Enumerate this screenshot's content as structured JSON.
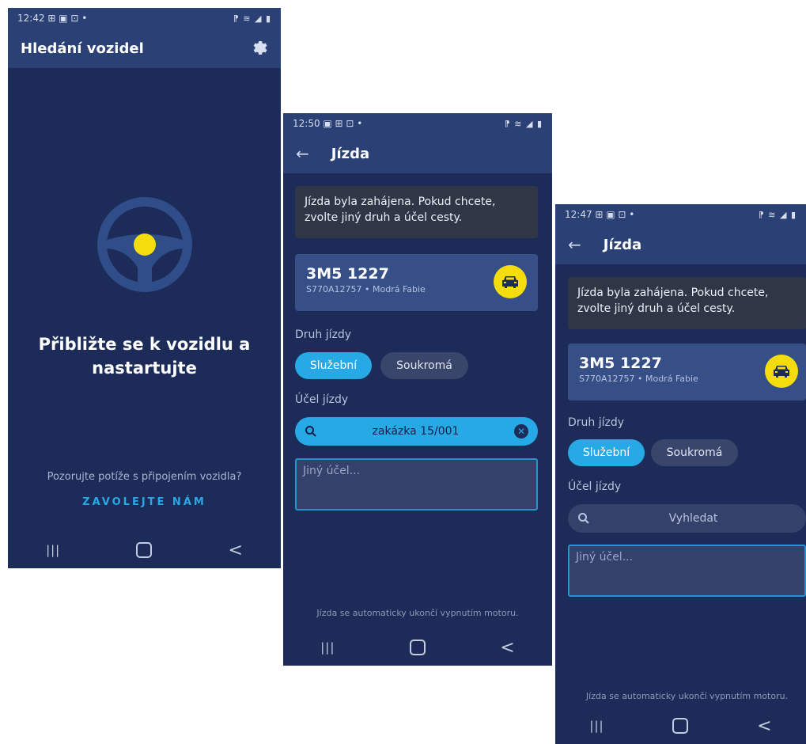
{
  "screen1": {
    "status": {
      "time": "12:42 ⊞ ▣ ⊡ •",
      "right": "⁋ ≋ ◢ ▮"
    },
    "title": "Hledání vozidel",
    "settings_icon": "gear-icon",
    "steering_icon": "steering-wheel-icon",
    "main_text": "Přibližte se k vozidlu a nastartujte",
    "trouble_text": "Pozorujte potíže s připojením vozidla?",
    "call_link": "ZAVOLEJTE NÁM",
    "nav": {
      "recent": "|||",
      "back": "<"
    }
  },
  "screen2": {
    "status": {
      "time": "12:50 ▣ ⊞ ⊡ •",
      "right": "⁋ ≋ ◢ ▮"
    },
    "back_icon": "←",
    "title": "Jízda",
    "info": "Jízda byla zahájena. Pokud chcete, zvolte jiný druh a účel cesty.",
    "vehicle": {
      "plate": "3M5 1227",
      "sub": "S770A12757 • Modrá Fabie",
      "icon": "car-icon"
    },
    "type_label": "Druh jízdy",
    "chips": [
      "Služební",
      "Soukromá"
    ],
    "purpose_label": "Účel jízdy",
    "search_value": "zakázka 15/001",
    "clear_glyph": "✕",
    "other_placeholder": "Jiný účel...",
    "footer": "Jízda se automaticky ukončí vypnutím motoru.",
    "nav": {
      "recent": "|||",
      "back": "<"
    }
  },
  "screen3": {
    "status": {
      "time": "12:47 ⊞ ▣ ⊡ •",
      "right": "⁋ ≋ ◢ ▮"
    },
    "back_icon": "←",
    "title": "Jízda",
    "info": "Jízda byla zahájena. Pokud chcete, zvolte jiný druh a účel cesty.",
    "vehicle": {
      "plate": "3M5 1227",
      "sub": "S770A12757 • Modrá Fabie",
      "icon": "car-icon"
    },
    "type_label": "Druh jízdy",
    "chips": [
      "Služební",
      "Soukromá"
    ],
    "purpose_label": "Účel jízdy",
    "search_placeholder": "Vyhledat",
    "other_placeholder": "Jiný účel...",
    "footer": "Jízda se automaticky ukončí vypnutím motoru.",
    "nav": {
      "recent": "|||",
      "back": "<"
    }
  },
  "colors": {
    "background": "#1c2b58",
    "appbar": "#2b4175",
    "accent": "#27a9e6",
    "yellow": "#f5dd0d"
  }
}
